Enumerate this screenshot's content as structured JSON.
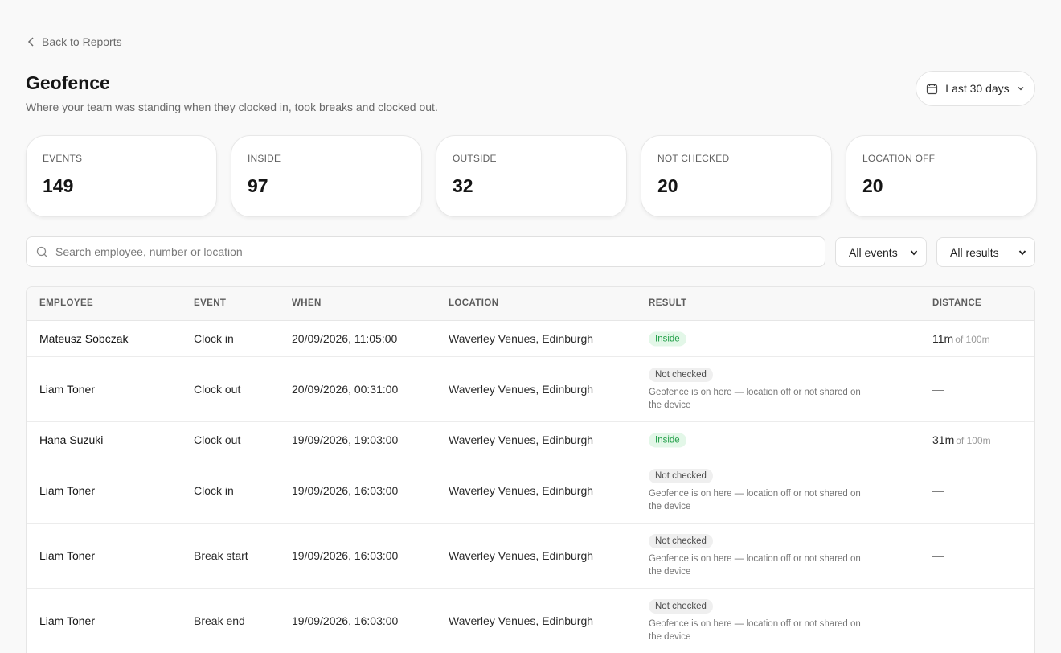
{
  "nav": {
    "back_label": "Back to Reports"
  },
  "header": {
    "title": "Geofence",
    "subtitle": "Where your team was standing when they clocked in, took breaks and clocked out.",
    "date_range": "Last 30 days"
  },
  "stats": [
    {
      "label": "EVENTS",
      "value": "149"
    },
    {
      "label": "INSIDE",
      "value": "97"
    },
    {
      "label": "OUTSIDE",
      "value": "32"
    },
    {
      "label": "NOT CHECKED",
      "value": "20"
    },
    {
      "label": "LOCATION OFF",
      "value": "20"
    }
  ],
  "filters": {
    "search_placeholder": "Search employee, number or location",
    "events_value": "All events",
    "results_value": "All results"
  },
  "table": {
    "columns": [
      "EMPLOYEE",
      "EVENT",
      "WHEN",
      "LOCATION",
      "RESULT",
      "DISTANCE"
    ],
    "rows": [
      {
        "employee": "Mateusz Sobczak",
        "event": "Clock in",
        "when": "20/09/2026, 11:05:00",
        "location": "Waverley Venues, Edinburgh",
        "result": "Inside",
        "note": "",
        "distance": "11m",
        "distance_of": "of 100m"
      },
      {
        "employee": "Liam Toner",
        "event": "Clock out",
        "when": "20/09/2026, 00:31:00",
        "location": "Waverley Venues, Edinburgh",
        "result": "Not checked",
        "note": "Geofence is on here — location off or not shared on the device",
        "distance": "—",
        "distance_of": ""
      },
      {
        "employee": "Hana Suzuki",
        "event": "Clock out",
        "when": "19/09/2026, 19:03:00",
        "location": "Waverley Venues, Edinburgh",
        "result": "Inside",
        "note": "",
        "distance": "31m",
        "distance_of": "of 100m"
      },
      {
        "employee": "Liam Toner",
        "event": "Clock in",
        "when": "19/09/2026, 16:03:00",
        "location": "Waverley Venues, Edinburgh",
        "result": "Not checked",
        "note": "Geofence is on here — location off or not shared on the device",
        "distance": "—",
        "distance_of": ""
      },
      {
        "employee": "Liam Toner",
        "event": "Break start",
        "when": "19/09/2026, 16:03:00",
        "location": "Waverley Venues, Edinburgh",
        "result": "Not checked",
        "note": "Geofence is on here — location off or not shared on the device",
        "distance": "—",
        "distance_of": ""
      },
      {
        "employee": "Liam Toner",
        "event": "Break end",
        "when": "19/09/2026, 16:03:00",
        "location": "Waverley Venues, Edinburgh",
        "result": "Not checked",
        "note": "Geofence is on here — location off or not shared on the device",
        "distance": "—",
        "distance_of": ""
      }
    ]
  },
  "colors": {
    "inside_badge": "#1f9e46",
    "not_checked_badge": "#4b4b4b",
    "background": "#f9f9f9"
  },
  "icons": {
    "back": "chevron-left-icon",
    "calendar": "calendar-icon",
    "search": "search-icon",
    "dropdown": "chevron-down-icon"
  }
}
